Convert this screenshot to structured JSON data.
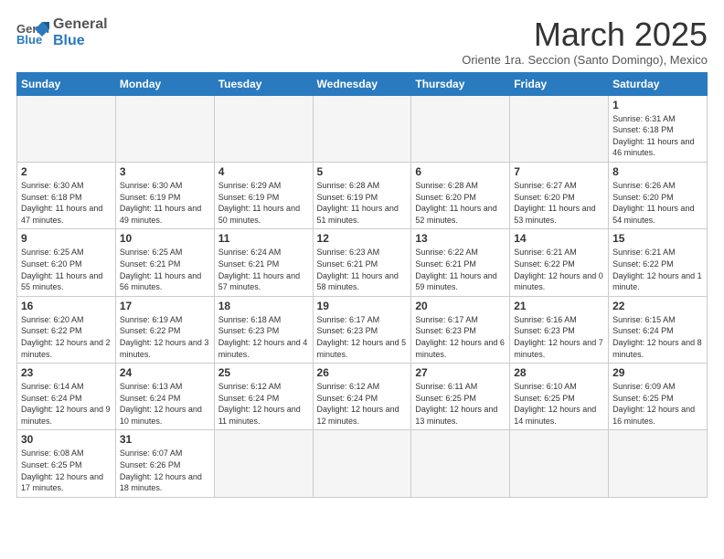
{
  "logo": {
    "general": "General",
    "blue": "Blue"
  },
  "title": "March 2025",
  "subtitle": "Oriente 1ra. Seccion (Santo Domingo), Mexico",
  "days_of_week": [
    "Sunday",
    "Monday",
    "Tuesday",
    "Wednesday",
    "Thursday",
    "Friday",
    "Saturday"
  ],
  "weeks": [
    [
      {
        "day": "",
        "info": ""
      },
      {
        "day": "",
        "info": ""
      },
      {
        "day": "",
        "info": ""
      },
      {
        "day": "",
        "info": ""
      },
      {
        "day": "",
        "info": ""
      },
      {
        "day": "",
        "info": ""
      },
      {
        "day": "1",
        "info": "Sunrise: 6:31 AM\nSunset: 6:18 PM\nDaylight: 11 hours and 46 minutes."
      }
    ],
    [
      {
        "day": "2",
        "info": "Sunrise: 6:30 AM\nSunset: 6:18 PM\nDaylight: 11 hours and 47 minutes."
      },
      {
        "day": "3",
        "info": "Sunrise: 6:30 AM\nSunset: 6:19 PM\nDaylight: 11 hours and 49 minutes."
      },
      {
        "day": "4",
        "info": "Sunrise: 6:29 AM\nSunset: 6:19 PM\nDaylight: 11 hours and 50 minutes."
      },
      {
        "day": "5",
        "info": "Sunrise: 6:28 AM\nSunset: 6:19 PM\nDaylight: 11 hours and 51 minutes."
      },
      {
        "day": "6",
        "info": "Sunrise: 6:28 AM\nSunset: 6:20 PM\nDaylight: 11 hours and 52 minutes."
      },
      {
        "day": "7",
        "info": "Sunrise: 6:27 AM\nSunset: 6:20 PM\nDaylight: 11 hours and 53 minutes."
      },
      {
        "day": "8",
        "info": "Sunrise: 6:26 AM\nSunset: 6:20 PM\nDaylight: 11 hours and 54 minutes."
      }
    ],
    [
      {
        "day": "9",
        "info": "Sunrise: 6:25 AM\nSunset: 6:20 PM\nDaylight: 11 hours and 55 minutes."
      },
      {
        "day": "10",
        "info": "Sunrise: 6:25 AM\nSunset: 6:21 PM\nDaylight: 11 hours and 56 minutes."
      },
      {
        "day": "11",
        "info": "Sunrise: 6:24 AM\nSunset: 6:21 PM\nDaylight: 11 hours and 57 minutes."
      },
      {
        "day": "12",
        "info": "Sunrise: 6:23 AM\nSunset: 6:21 PM\nDaylight: 11 hours and 58 minutes."
      },
      {
        "day": "13",
        "info": "Sunrise: 6:22 AM\nSunset: 6:21 PM\nDaylight: 11 hours and 59 minutes."
      },
      {
        "day": "14",
        "info": "Sunrise: 6:21 AM\nSunset: 6:22 PM\nDaylight: 12 hours and 0 minutes."
      },
      {
        "day": "15",
        "info": "Sunrise: 6:21 AM\nSunset: 6:22 PM\nDaylight: 12 hours and 1 minute."
      }
    ],
    [
      {
        "day": "16",
        "info": "Sunrise: 6:20 AM\nSunset: 6:22 PM\nDaylight: 12 hours and 2 minutes."
      },
      {
        "day": "17",
        "info": "Sunrise: 6:19 AM\nSunset: 6:22 PM\nDaylight: 12 hours and 3 minutes."
      },
      {
        "day": "18",
        "info": "Sunrise: 6:18 AM\nSunset: 6:23 PM\nDaylight: 12 hours and 4 minutes."
      },
      {
        "day": "19",
        "info": "Sunrise: 6:17 AM\nSunset: 6:23 PM\nDaylight: 12 hours and 5 minutes."
      },
      {
        "day": "20",
        "info": "Sunrise: 6:17 AM\nSunset: 6:23 PM\nDaylight: 12 hours and 6 minutes."
      },
      {
        "day": "21",
        "info": "Sunrise: 6:16 AM\nSunset: 6:23 PM\nDaylight: 12 hours and 7 minutes."
      },
      {
        "day": "22",
        "info": "Sunrise: 6:15 AM\nSunset: 6:24 PM\nDaylight: 12 hours and 8 minutes."
      }
    ],
    [
      {
        "day": "23",
        "info": "Sunrise: 6:14 AM\nSunset: 6:24 PM\nDaylight: 12 hours and 9 minutes."
      },
      {
        "day": "24",
        "info": "Sunrise: 6:13 AM\nSunset: 6:24 PM\nDaylight: 12 hours and 10 minutes."
      },
      {
        "day": "25",
        "info": "Sunrise: 6:12 AM\nSunset: 6:24 PM\nDaylight: 12 hours and 11 minutes."
      },
      {
        "day": "26",
        "info": "Sunrise: 6:12 AM\nSunset: 6:24 PM\nDaylight: 12 hours and 12 minutes."
      },
      {
        "day": "27",
        "info": "Sunrise: 6:11 AM\nSunset: 6:25 PM\nDaylight: 12 hours and 13 minutes."
      },
      {
        "day": "28",
        "info": "Sunrise: 6:10 AM\nSunset: 6:25 PM\nDaylight: 12 hours and 14 minutes."
      },
      {
        "day": "29",
        "info": "Sunrise: 6:09 AM\nSunset: 6:25 PM\nDaylight: 12 hours and 16 minutes."
      }
    ],
    [
      {
        "day": "30",
        "info": "Sunrise: 6:08 AM\nSunset: 6:25 PM\nDaylight: 12 hours and 17 minutes."
      },
      {
        "day": "31",
        "info": "Sunrise: 6:07 AM\nSunset: 6:26 PM\nDaylight: 12 hours and 18 minutes."
      },
      {
        "day": "",
        "info": ""
      },
      {
        "day": "",
        "info": ""
      },
      {
        "day": "",
        "info": ""
      },
      {
        "day": "",
        "info": ""
      },
      {
        "day": "",
        "info": ""
      }
    ]
  ],
  "colors": {
    "header_bg": "#2a7abf",
    "header_text": "#ffffff",
    "border": "#cccccc",
    "empty_bg": "#f5f5f5"
  }
}
